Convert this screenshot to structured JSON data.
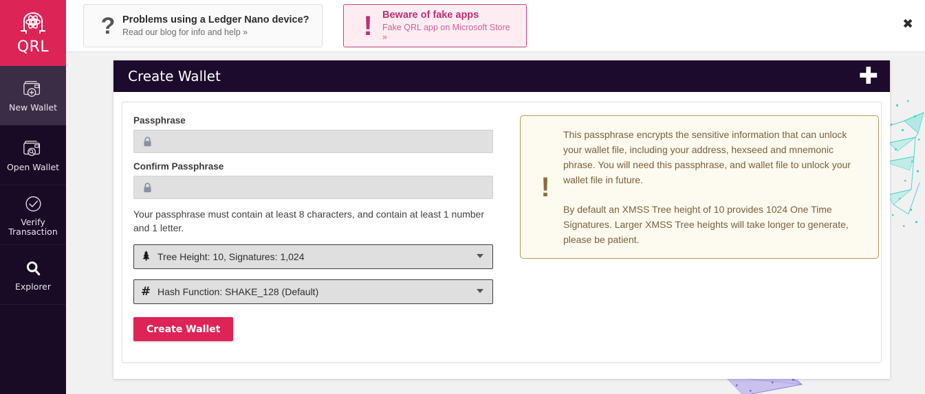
{
  "brand": {
    "name": "QRL",
    "logo_icon": "qrl-atom-logo-icon"
  },
  "sidebar": {
    "items": [
      {
        "label": "New Wallet",
        "icon": "wallet-add-icon",
        "active": true
      },
      {
        "label": "Open Wallet",
        "icon": "wallet-search-icon",
        "active": false
      },
      {
        "label": "Verify\nTransaction",
        "label_line1": "Verify",
        "label_line2": "Transaction",
        "icon": "check-circle-icon",
        "active": false
      },
      {
        "label": "Explorer",
        "icon": "magnifier-icon",
        "active": false
      }
    ]
  },
  "topbar": {
    "banners": [
      {
        "icon": "question-mark-icon",
        "title": "Problems using a Ledger Nano device?",
        "subtitle": "Read our blog for info and help »"
      },
      {
        "icon": "exclamation-mark-icon",
        "title": "Beware of fake apps",
        "subtitle": "Fake QRL app on Microsoft Store »"
      }
    ],
    "close_label": "✖",
    "close_icon": "close-icon"
  },
  "card": {
    "title": "Create Wallet",
    "plus_label": "✚",
    "plus_icon": "plus-icon"
  },
  "form": {
    "passphrase_label": "Passphrase",
    "passphrase_value": "",
    "passphrase_placeholder": "",
    "confirm_label": "Confirm Passphrase",
    "confirm_value": "",
    "confirm_placeholder": "",
    "lock_icon": "lock-icon",
    "hint": "Your passphrase must contain at least 8 characters, and contain at least 1 number and 1 letter.",
    "tree_height_icon": "evergreen-tree-icon",
    "tree_height_value": "Tree Height: 10, Signatures: 1,024",
    "hash_function_icon": "hash-icon",
    "hash_function_glyph": "#",
    "hash_function_value": "Hash Function: SHAKE_128 (Default)",
    "submit_label": "Create Wallet"
  },
  "info": {
    "icon": "exclamation-mark-icon",
    "glyph": "!",
    "paragraph1": "This passphrase encrypts the sensitive information that can unlock your wallet file, including your address, hexseed and mnemonic phrase. You will need this passphrase, and wallet file to unlock your wallet file in future.",
    "paragraph2": "By default an XMSS Tree height of 10 provides 1024 One Time Signatures. Larger XMSS Tree heights will take longer to generate, please be patient."
  },
  "colors": {
    "brand_pink": "#dd2456",
    "sidebar_dark": "#190a26",
    "sidebar_active": "#3b2d46",
    "header_dark": "#1d0b2e",
    "info_bg": "#fdfaf0",
    "info_border": "#b99b5e",
    "info_text": "#7a6038",
    "page_bg": "#f1f1f1",
    "decor_teal": "#3fd4c8",
    "decor_purple": "#6e5ae0"
  }
}
